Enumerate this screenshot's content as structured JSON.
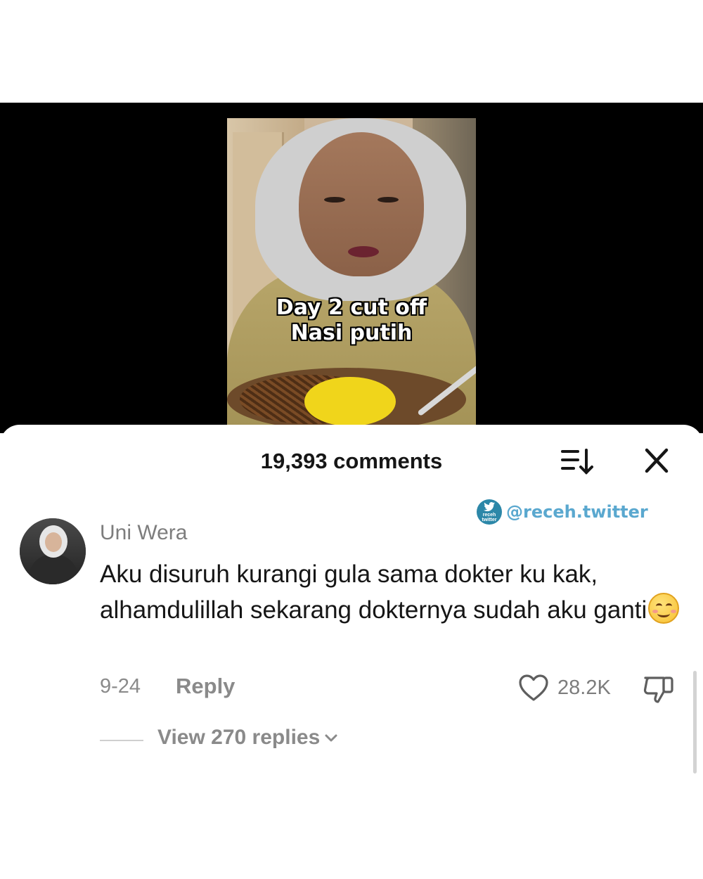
{
  "video": {
    "caption_line1": "Day 2 cut off",
    "caption_line2": "Nasi putih"
  },
  "comments_sheet": {
    "title": "19,393 comments",
    "sort_icon": "sort-icon",
    "close_icon": "close-icon"
  },
  "watermark": {
    "logo_text": "receh twitter",
    "handle": "@receh.twitter",
    "color": "#5aa8cf"
  },
  "comment": {
    "username": "Uni Wera",
    "text": "Aku disuruh kurangi gula sama dokter ku kak, alhamdulillah sekarang dokternya sudah aku ganti",
    "emoji": "smiling-face-emoji",
    "date": "9-24",
    "reply_label": "Reply",
    "like_count": "28.2K",
    "view_replies": "View 270 replies"
  }
}
